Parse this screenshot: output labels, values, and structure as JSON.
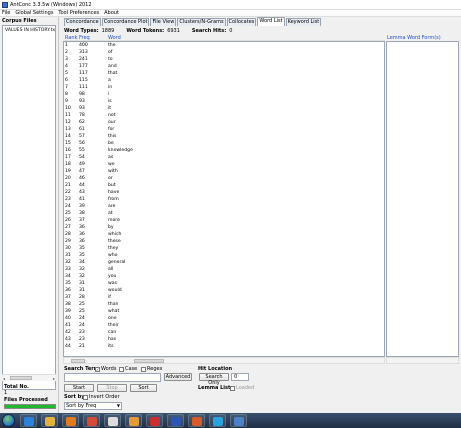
{
  "window": {
    "title": "AntConc 3.3.5w (Windows) 2012"
  },
  "menu": [
    "File",
    "Global Settings",
    "Tool Preferences",
    "About"
  ],
  "corpus": {
    "label": "Corpus Files",
    "files": [
      "VALUES IN HISTORY.tx"
    ],
    "total_label": "Total No.",
    "total_value": "1",
    "files_processed_label": "Files Processed",
    "files_processed_progress": 1.0
  },
  "tabs": [
    "Concordance",
    "Concordance Plot",
    "File View",
    "Clusters/N-Grams",
    "Collocates",
    "Word List",
    "Keyword List"
  ],
  "active_tab": "Word List",
  "stats": {
    "word_types_label": "Word Types:",
    "word_types": "1889",
    "word_tokens_label": "Word Tokens:",
    "word_tokens": "6931",
    "search_hits_label": "Search Hits:",
    "search_hits": "0"
  },
  "columns": {
    "rank": "Rank",
    "freq": "Freq",
    "word": "Word",
    "lemma": "Lemma Word Form(s)"
  },
  "rows": [
    [
      "1",
      "400",
      "the"
    ],
    [
      "2",
      "313",
      "of"
    ],
    [
      "3",
      "241",
      "to"
    ],
    [
      "4",
      "177",
      "and"
    ],
    [
      "5",
      "117",
      "that"
    ],
    [
      "6",
      "115",
      "a"
    ],
    [
      "7",
      "111",
      "in"
    ],
    [
      "8",
      "98",
      "i"
    ],
    [
      "9",
      "93",
      "is"
    ],
    [
      "10",
      "93",
      "it"
    ],
    [
      "11",
      "78",
      "not"
    ],
    [
      "12",
      "62",
      "our"
    ],
    [
      "13",
      "61",
      "for"
    ],
    [
      "14",
      "57",
      "this"
    ],
    [
      "15",
      "56",
      "be"
    ],
    [
      "16",
      "55",
      "knowledge"
    ],
    [
      "17",
      "54",
      "as"
    ],
    [
      "18",
      "49",
      "we"
    ],
    [
      "19",
      "47",
      "with"
    ],
    [
      "20",
      "46",
      "or"
    ],
    [
      "21",
      "44",
      "but"
    ],
    [
      "22",
      "43",
      "have"
    ],
    [
      "23",
      "41",
      "from"
    ],
    [
      "24",
      "39",
      "are"
    ],
    [
      "25",
      "38",
      "at"
    ],
    [
      "26",
      "37",
      "more"
    ],
    [
      "27",
      "36",
      "by"
    ],
    [
      "28",
      "36",
      "which"
    ],
    [
      "29",
      "36",
      "these"
    ],
    [
      "30",
      "35",
      "they"
    ],
    [
      "31",
      "35",
      "who"
    ],
    [
      "32",
      "34",
      "general"
    ],
    [
      "33",
      "32",
      "all"
    ],
    [
      "34",
      "32",
      "you"
    ],
    [
      "35",
      "31",
      "was"
    ],
    [
      "36",
      "31",
      "would"
    ],
    [
      "37",
      "28",
      "if"
    ],
    [
      "38",
      "25",
      "than"
    ],
    [
      "39",
      "25",
      "what"
    ],
    [
      "40",
      "24",
      "one"
    ],
    [
      "41",
      "24",
      "their"
    ],
    [
      "42",
      "23",
      "can"
    ],
    [
      "43",
      "23",
      "has"
    ],
    [
      "44",
      "21",
      "its"
    ]
  ],
  "search": {
    "label": "Search Term",
    "words_label": "Words",
    "words_checked": true,
    "case_label": "Case",
    "regex_label": "Regex",
    "value": "",
    "advanced": "Advanced",
    "hit_location_label": "Hit Location",
    "search_only": "Search Only",
    "spin_value": "0",
    "lemma_list_label": "Lemma List",
    "loaded_label": "Loaded"
  },
  "buttons": {
    "start": "Start",
    "stop": "Stop",
    "sort": "Sort"
  },
  "sort": {
    "label": "Sort by",
    "invert_label": "Invert Order",
    "selected": "Sort by Freq"
  },
  "taskbar": {
    "items": [
      {
        "icon": "ie-icon",
        "color": "#2b82d9"
      },
      {
        "icon": "folder-icon",
        "color": "#e2b33c"
      },
      {
        "icon": "media-player-icon",
        "color": "#e07a1f"
      },
      {
        "icon": "chrome-icon",
        "color": "#d64a3a"
      },
      {
        "icon": "wiki-icon",
        "color": "#dcdcdc"
      },
      {
        "icon": "paint-icon",
        "color": "#e59a3a"
      },
      {
        "icon": "pdf-icon",
        "color": "#c92f2f"
      },
      {
        "icon": "word-icon",
        "color": "#2a57b3"
      },
      {
        "icon": "powerpoint-icon",
        "color": "#d65b2c"
      },
      {
        "icon": "skype-icon",
        "color": "#28a3de"
      },
      {
        "icon": "antconc-icon",
        "color": "#4c83c6"
      }
    ]
  }
}
